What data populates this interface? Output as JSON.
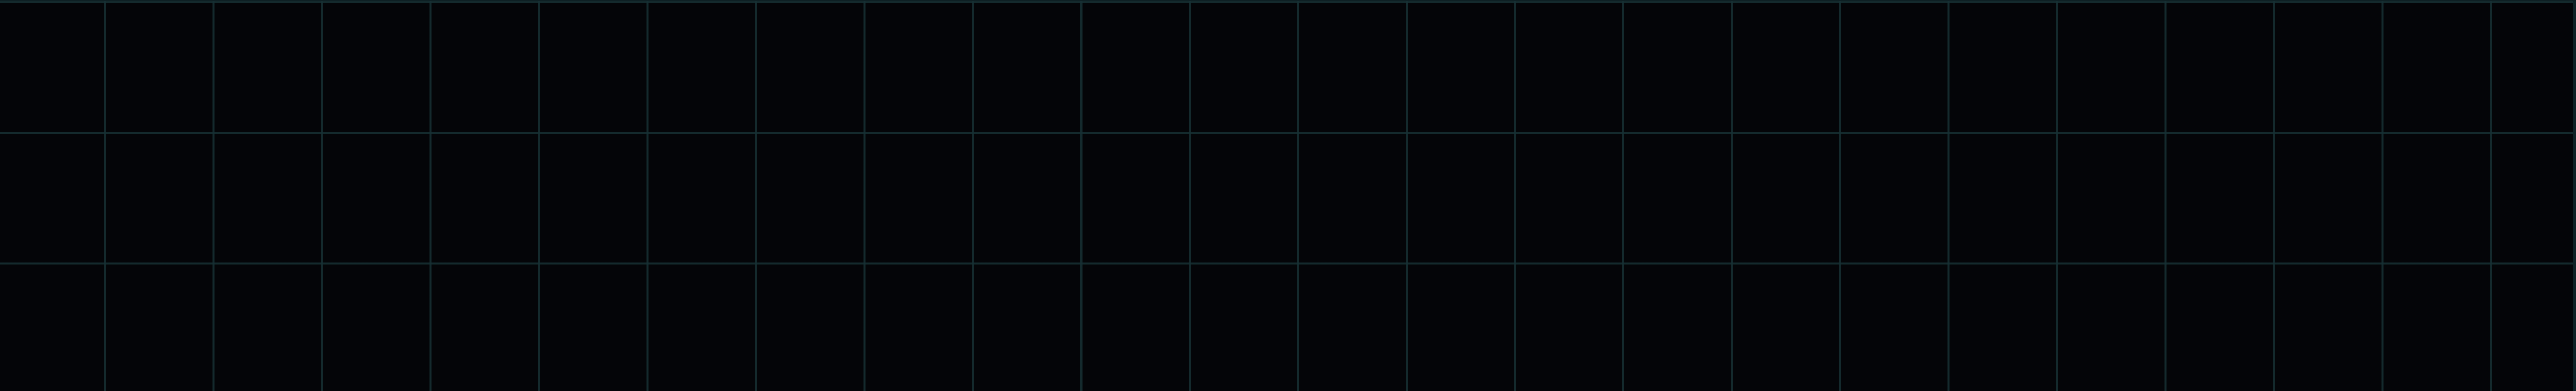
{
  "canvas": {
    "background_color": "#040508",
    "grid_line_color": "#163034",
    "grid_columns": 24,
    "grid_rows": 3
  }
}
